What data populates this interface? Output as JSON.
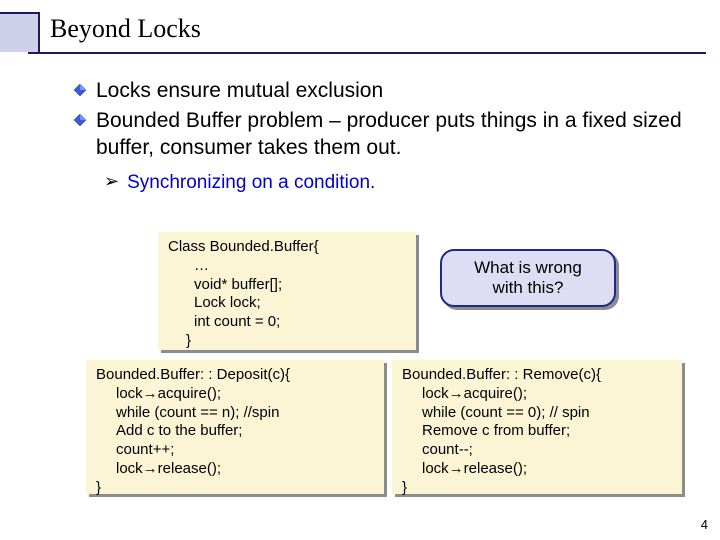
{
  "title": "Beyond Locks",
  "bullets": [
    {
      "text": "Locks ensure mutual exclusion"
    },
    {
      "text": "Bounded Buffer problem – producer puts things in a fixed sized buffer, consumer takes them out."
    }
  ],
  "sub_bullet": {
    "marker": "➢",
    "text": "Synchronizing on a condition."
  },
  "code": {
    "class_decl": {
      "line1": "Class Bounded.Buffer{",
      "indent": {
        "l1": "…",
        "l2": "void* buffer[];",
        "l3": "Lock lock;",
        "l4": "int count = 0;"
      },
      "close": "}"
    },
    "deposit": {
      "head": "Bounded.Buffer: : Deposit(c){",
      "body": {
        "l1": "lock→acquire();",
        "l2": "while (count == n); //spin",
        "l3": "Add c to the buffer;",
        "l4": "count++;",
        "l5": "lock→release();"
      },
      "close": "}"
    },
    "remove": {
      "head": "Bounded.Buffer: : Remove(c){",
      "body": {
        "l1": "lock→acquire();",
        "l2": "while (count == 0); // spin",
        "l3": "Remove c from buffer;",
        "l4": "count--;",
        "l5": "lock→release();"
      },
      "close": "}"
    }
  },
  "callout": "What is wrong\nwith this?",
  "page_number": "4"
}
